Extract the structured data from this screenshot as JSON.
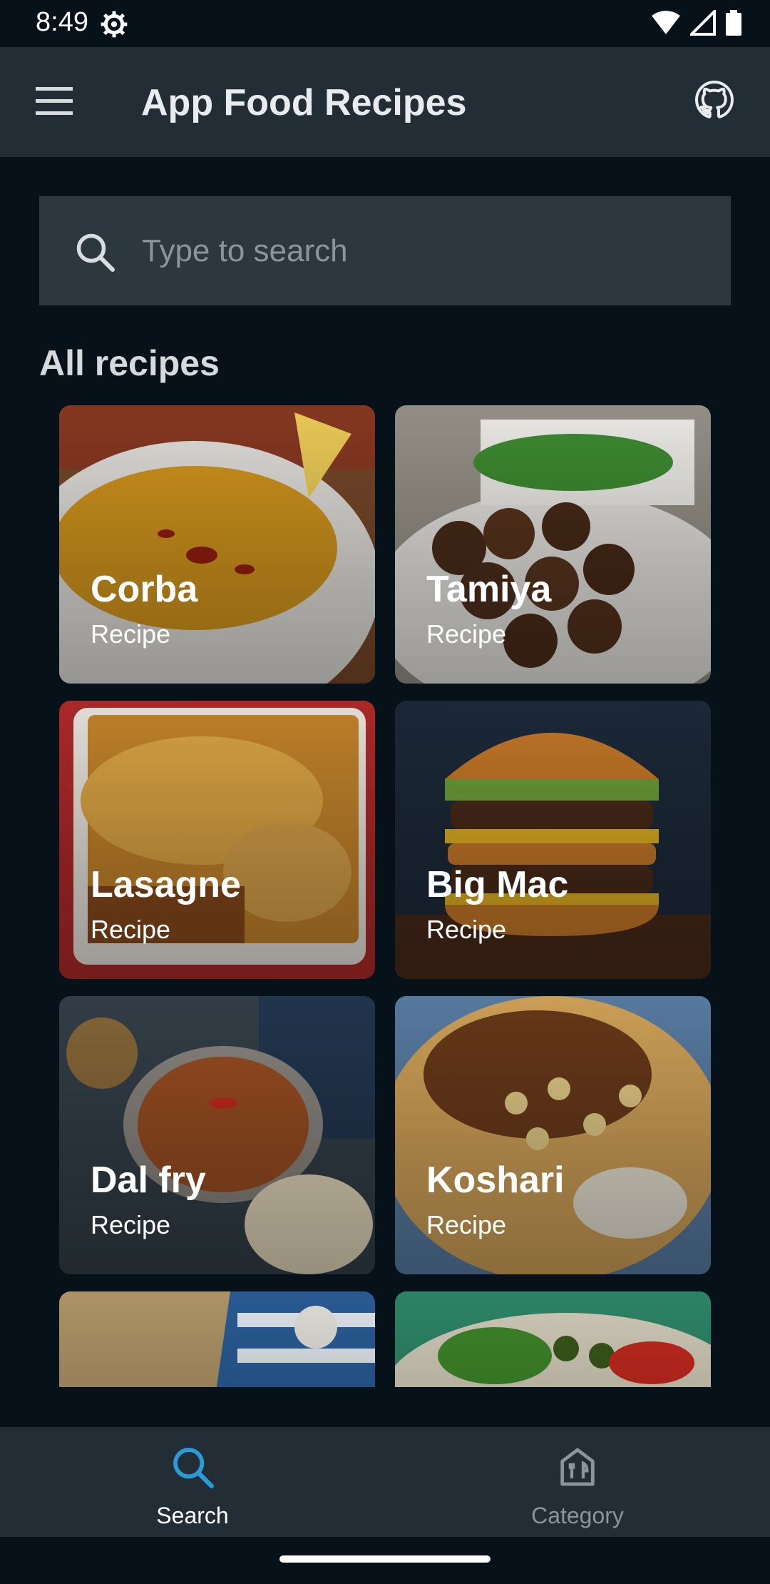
{
  "status": {
    "time": "8:49"
  },
  "app_bar": {
    "title": "App Food Recipes"
  },
  "search": {
    "placeholder": "Type to search"
  },
  "section": {
    "title": "All recipes"
  },
  "recipes": [
    {
      "name": "Corba",
      "sub": "Recipe"
    },
    {
      "name": "Tamiya",
      "sub": "Recipe"
    },
    {
      "name": "Lasagne",
      "sub": "Recipe"
    },
    {
      "name": "Big Mac",
      "sub": "Recipe"
    },
    {
      "name": "Dal fry",
      "sub": "Recipe"
    },
    {
      "name": "Koshari",
      "sub": "Recipe"
    },
    {
      "name": "",
      "sub": ""
    },
    {
      "name": "",
      "sub": ""
    }
  ],
  "bottom_nav": {
    "items": [
      {
        "label": "Search",
        "active": true
      },
      {
        "label": "Category",
        "active": false
      }
    ]
  },
  "colors": {
    "accent": "#2b9bd8",
    "app_bar": "#232d35",
    "background": "#061119"
  }
}
